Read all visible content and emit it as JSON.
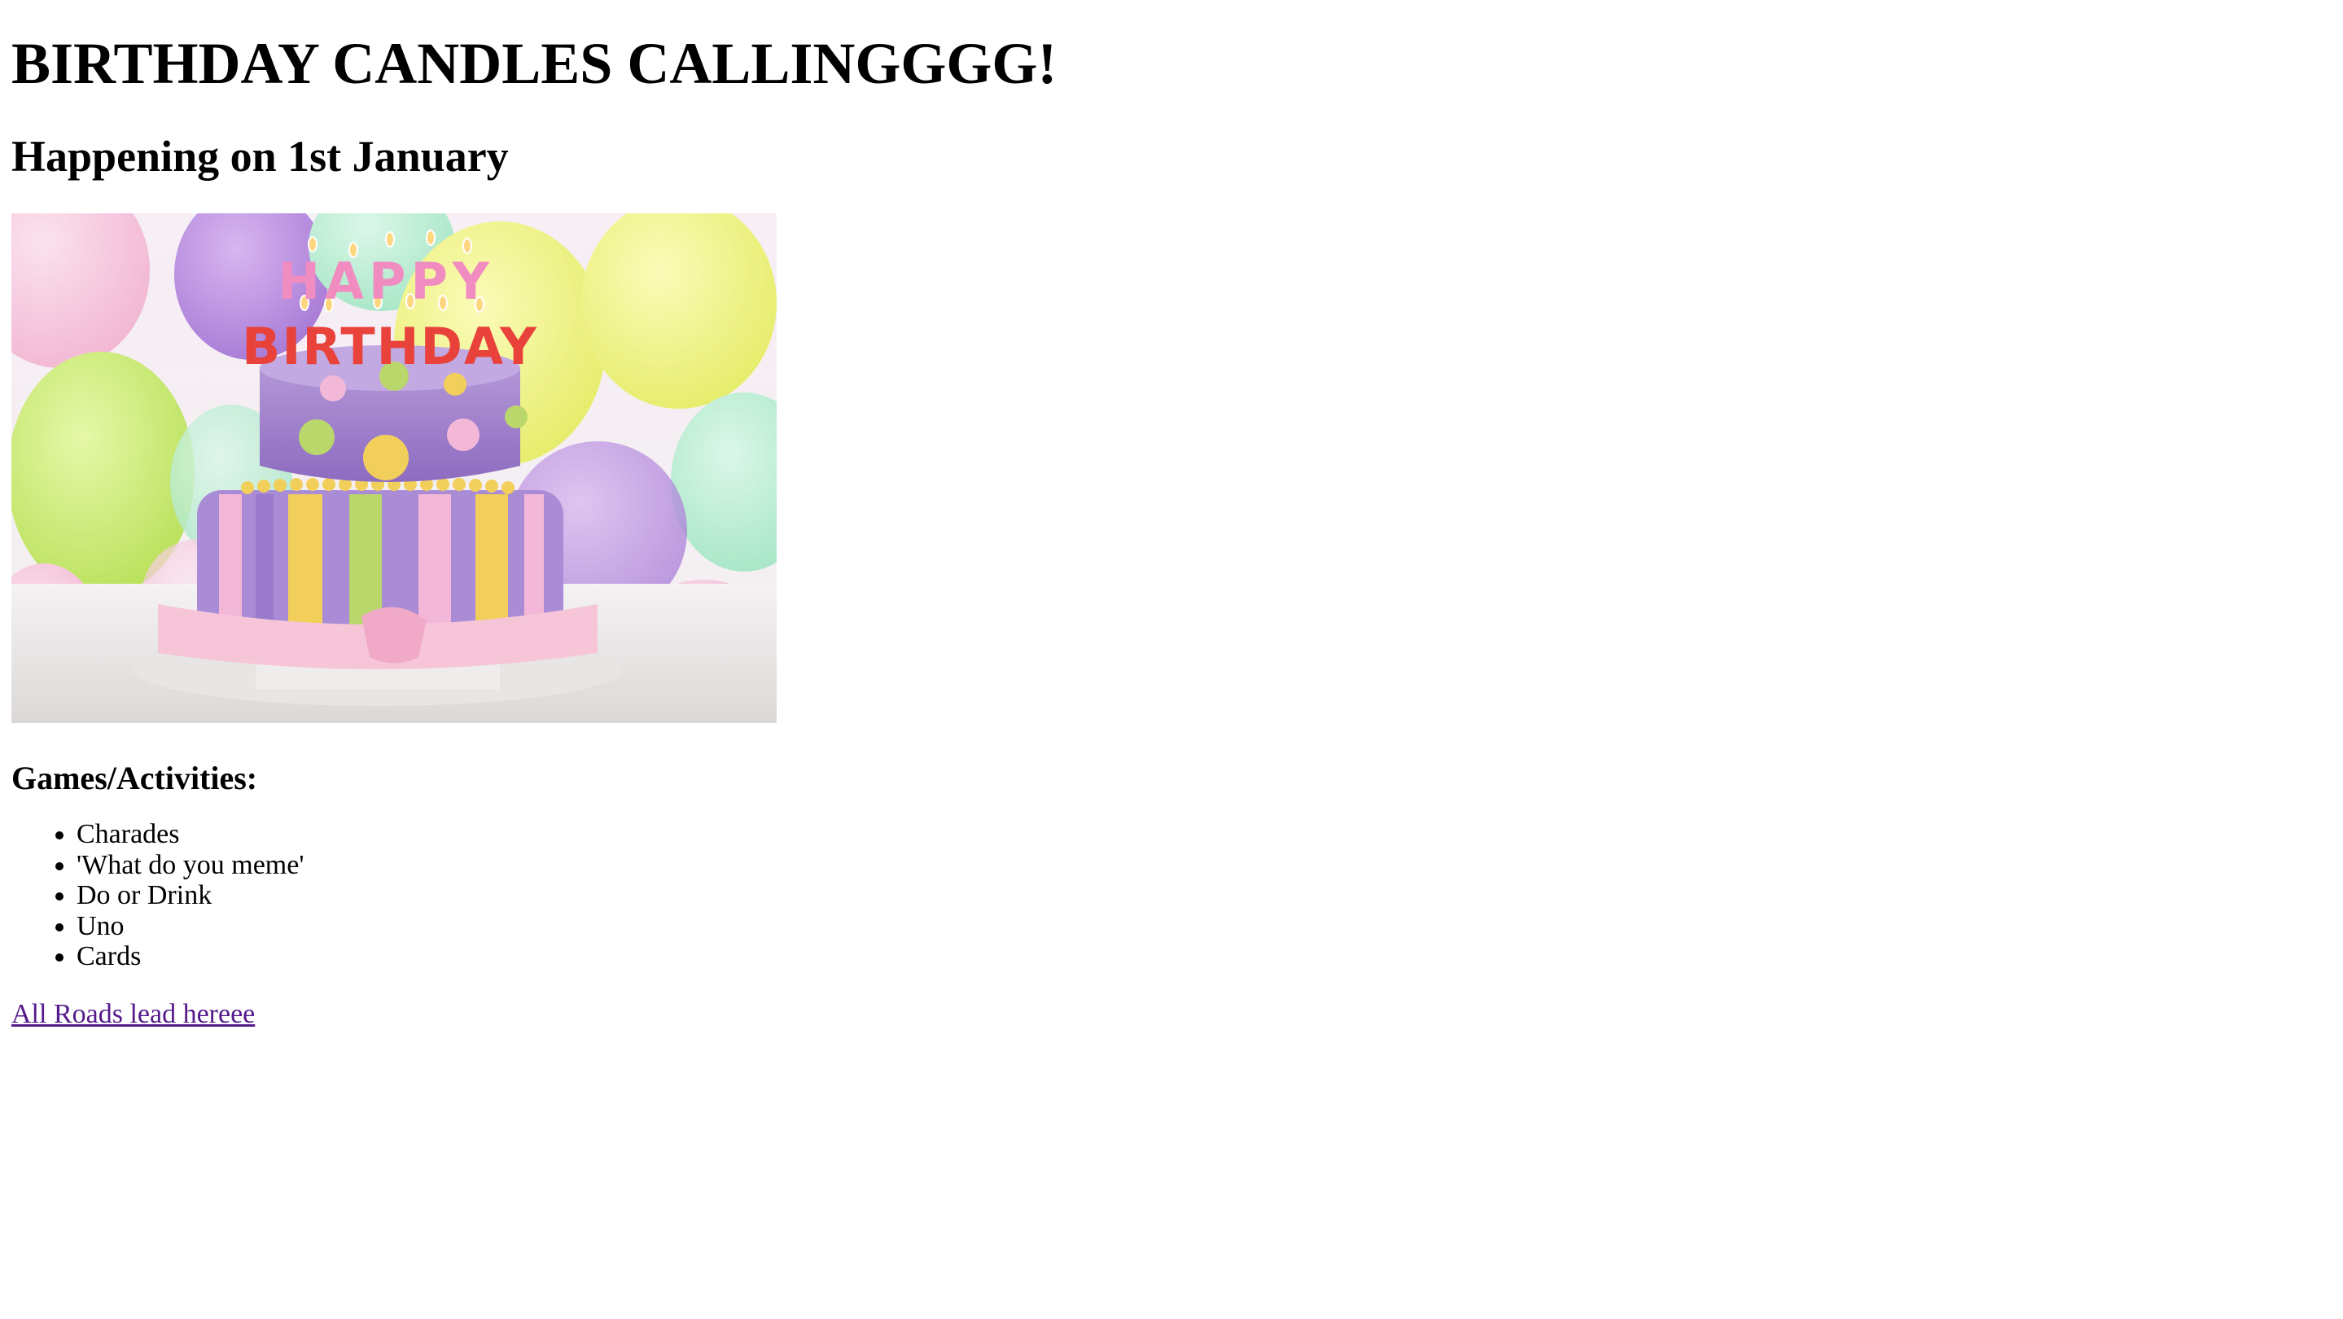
{
  "page": {
    "title": "BIRTHDAY CANDLES CALLINGGGG!",
    "subtitle": "Happening on 1st January",
    "image": {
      "icon": "birthday-cake-image",
      "cake_text_top": "HAPPY",
      "cake_text_bottom": "BIRTHDAY"
    },
    "activities_heading": "Games/Activities:",
    "activities": [
      "Charades",
      "'What do you meme'",
      "Do or Drink",
      "Uno",
      "Cards"
    ],
    "link_text": "All Roads lead hereee"
  },
  "colors": {
    "visited_link": "#551a8b",
    "text": "#000000",
    "background": "#ffffff"
  }
}
